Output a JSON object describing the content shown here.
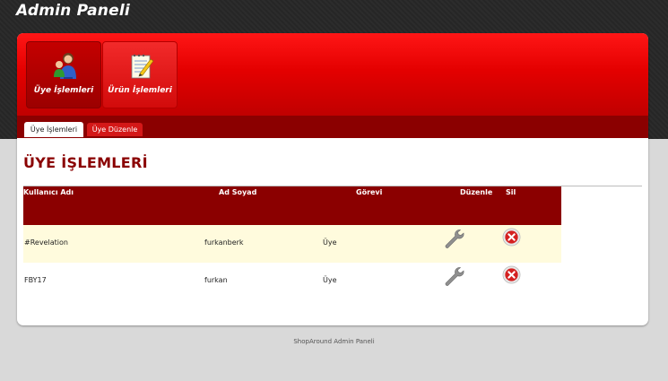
{
  "header": {
    "site_title": "Admin Paneli"
  },
  "nav": {
    "items": [
      {
        "label": "Üye İşlemleri",
        "icon": "user-group-icon",
        "active": true
      },
      {
        "label": "Ürün İşlemleri",
        "icon": "notepad-edit-icon",
        "active": false
      }
    ]
  },
  "tabs": [
    {
      "label": "Üye İşlemleri",
      "active": true
    },
    {
      "label": "Üye Düzenle",
      "active": false
    }
  ],
  "main": {
    "title": "ÜYE İŞLEMLERİ"
  },
  "table": {
    "headers": {
      "username": "Kullanıcı Adı",
      "fullname": "Ad Soyad",
      "role": "Görevi",
      "edit": "Düzenle",
      "delete": "Sil"
    },
    "rows": [
      {
        "username": "#Revelation",
        "fullname": "furkanberk",
        "role": "Üye"
      },
      {
        "username": "FBY17",
        "fullname": "furkan",
        "role": "Üye"
      }
    ]
  },
  "footer": {
    "text": "ShopAround Admin Paneli"
  },
  "colors": {
    "brand_red": "#e00000",
    "dark_red": "#8b0000",
    "row_highlight": "#fffbdd"
  }
}
